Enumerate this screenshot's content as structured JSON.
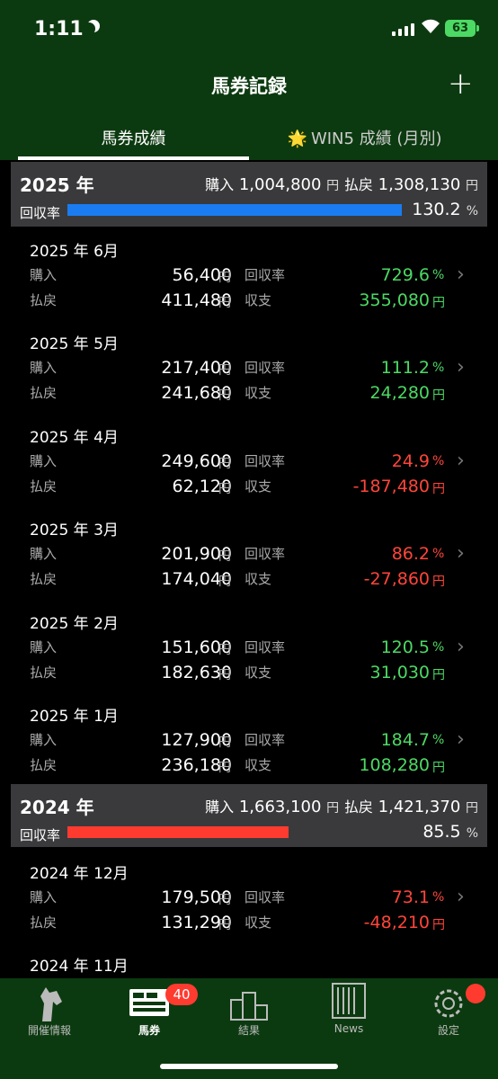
{
  "status": {
    "time": "1:11",
    "battery": "63"
  },
  "header": {
    "title": "馬券記録",
    "add_label": "+"
  },
  "tabs": [
    {
      "label": "馬券成績"
    },
    {
      "label": "WIN5 成績 (月別)"
    }
  ],
  "labels": {
    "buy": "購入",
    "payout": "払戻",
    "rate": "回収率",
    "balance": "収支",
    "yen": "円",
    "pct": "%"
  },
  "years": [
    {
      "year": "2025 年",
      "buy": "1,004,800",
      "payout": "1,308,130",
      "rate": "130.2",
      "rate_fraction": 1.0,
      "bar_color": "#1a7cf0"
    },
    {
      "year": "2024 年",
      "buy": "1,663,100",
      "payout": "1,421,370",
      "rate": "85.5",
      "rate_fraction": 0.66,
      "bar_color": "#ff3b30"
    }
  ],
  "months": [
    {
      "title": "2025 年 6月",
      "buy": "56,400",
      "payout": "411,480",
      "rate": "729.6",
      "balance": "355,080",
      "positive": true
    },
    {
      "title": "2025 年 5月",
      "buy": "217,400",
      "payout": "241,680",
      "rate": "111.2",
      "balance": "24,280",
      "positive": true
    },
    {
      "title": "2025 年 4月",
      "buy": "249,600",
      "payout": "62,120",
      "rate": "24.9",
      "balance": "-187,480",
      "positive": false
    },
    {
      "title": "2025 年 3月",
      "buy": "201,900",
      "payout": "174,040",
      "rate": "86.2",
      "balance": "-27,860",
      "positive": false
    },
    {
      "title": "2025 年 2月",
      "buy": "151,600",
      "payout": "182,630",
      "rate": "120.5",
      "balance": "31,030",
      "positive": true
    },
    {
      "title": "2025 年 1月",
      "buy": "127,900",
      "payout": "236,180",
      "rate": "184.7",
      "balance": "108,280",
      "positive": true
    },
    {
      "title": "2024 年 12月",
      "buy": "179,500",
      "payout": "131,290",
      "rate": "73.1",
      "balance": "-48,210",
      "positive": false
    },
    {
      "title": "2024 年 11月"
    }
  ],
  "tabbar": {
    "items": [
      {
        "label": "開催情報",
        "icon": "horse-head-icon"
      },
      {
        "label": "馬券",
        "icon": "ticket-icon"
      },
      {
        "label": "結果",
        "icon": "podium-icon"
      },
      {
        "label": "News",
        "icon": "news-icon"
      },
      {
        "label": "設定",
        "icon": "gear-icon"
      }
    ],
    "badge": "40"
  },
  "colors": {
    "header_green": "#0c3a10",
    "positive": "#4cd964",
    "negative": "#ff453a"
  }
}
